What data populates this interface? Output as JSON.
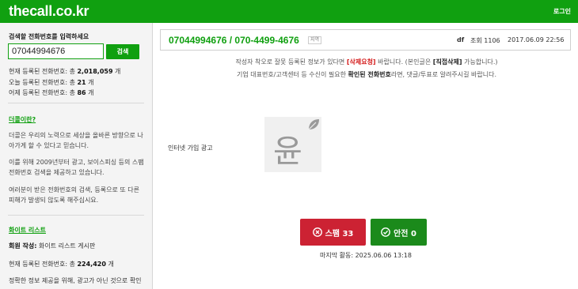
{
  "header": {
    "logo": "thecall.co.kr",
    "login": "로그인"
  },
  "sidebar": {
    "search_title": "검색할 전화번호를 입력하세요",
    "search_value": "07044994676",
    "search_button": "검색",
    "stats": [
      {
        "prefix": "현재 등록된 전화번호: 총 ",
        "value": "2,018,059",
        "suffix": " 개"
      },
      {
        "prefix": "오늘 등록된 전화번호: 총 ",
        "value": "21",
        "suffix": " 개"
      },
      {
        "prefix": "어제 등록된 전화번호: 총 ",
        "value": "86",
        "suffix": " 개"
      }
    ],
    "about_link": "더콜이란?",
    "about_p1": "더콜은 우리의 노력으로 세상을 올바른 방향으로 나아가게 할 수 있다고 믿습니다.",
    "about_p2": "이를 위해 2009년부터 광고, 보이스피싱 등의 스팸 전화번호 검색을 제공하고 있습니다.",
    "about_p3": "여러분이 받은 전화번호의 검색, 등록으로 또 다른 피해가 발생되 않도록 해주십시요.",
    "white_list_link": "화이트 리스트",
    "member_label": "회원 작성:",
    "member_value": " 화이트 리스트 게시판",
    "wl_count_prefix": "현재 등록된 전화번호: 총 ",
    "wl_count_value": "224,420",
    "wl_count_suffix": " 개",
    "wl_cut": "정확한 정보 제공을 위해, 광고가 아닌 것으로 확인"
  },
  "post": {
    "phone": "07044994676  /  070-4499-4676",
    "region_tag": "지역",
    "author": "df",
    "views": "조회 1106",
    "date": "2017.06.09 22:56"
  },
  "notice": {
    "line1_a": "작성자 착오로 잘못 등록된 정보가 있다면 ",
    "line1_b": "[삭제요청]",
    "line1_c": " 바랍니다. (본인글은 ",
    "line1_d": "[직접삭제]",
    "line1_e": " 가능합니다.)",
    "line2_a": "기업 대표번호/고객센터 등 수신이 필요한 ",
    "line2_b": "확인된 전화번호",
    "line2_c": "라면, 댓글/투표로 알려주시길 바랍니다."
  },
  "content": {
    "text": "인터넷 가입 광고",
    "image_char": "윤"
  },
  "votes": {
    "spam": "스팸 33",
    "safe": "안전 0",
    "last_active": "마지막 활동: 2025.06.06 13:18"
  },
  "colors": {
    "brand": "#10a010",
    "spam": "#cc2233",
    "safe": "#1b8a1b"
  }
}
